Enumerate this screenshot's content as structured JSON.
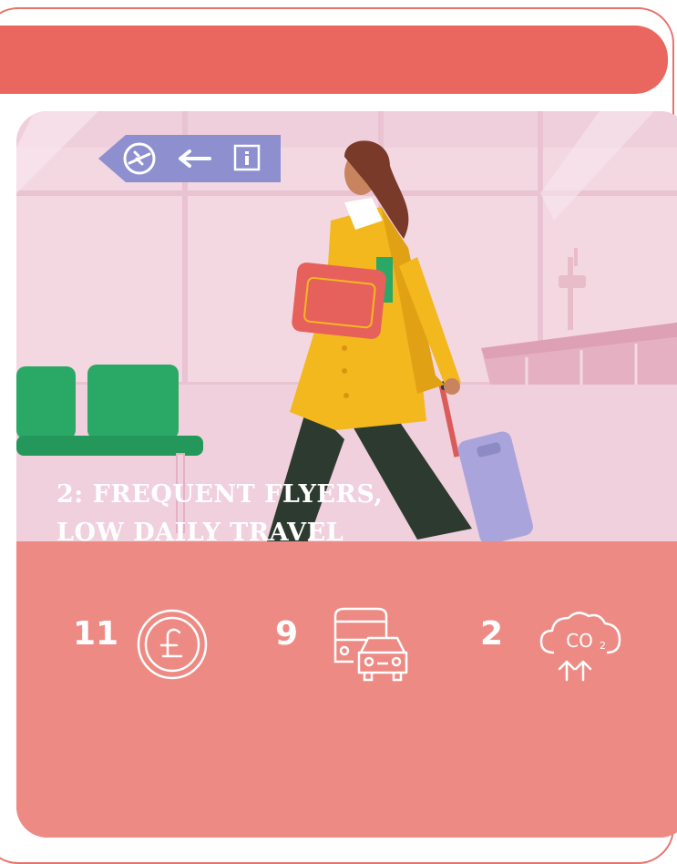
{
  "persona": {
    "title_line1": "2: FREQUENT FLYERS,",
    "title_line2": "LOW DAILY TRAVEL"
  },
  "stats": [
    {
      "value": "11",
      "icon": "pound-coin-icon"
    },
    {
      "value": "9",
      "icon": "bus-car-icon"
    },
    {
      "value": "2",
      "icon": "co2-cloud-icon"
    }
  ],
  "illustration": {
    "sign_icons": [
      "airplane-departure-icon",
      "arrow-left-icon",
      "info-icon"
    ],
    "subject": "woman-with-suitcase-illustration"
  },
  "colors": {
    "banner": "#e9675f",
    "card_bottom": "#ee8a84",
    "background_scene": "#f4d9e3",
    "coat": "#f3b81e",
    "seats": "#2aa865",
    "suitcase": "#a9a5dc",
    "sign": "#8d8fcf"
  }
}
